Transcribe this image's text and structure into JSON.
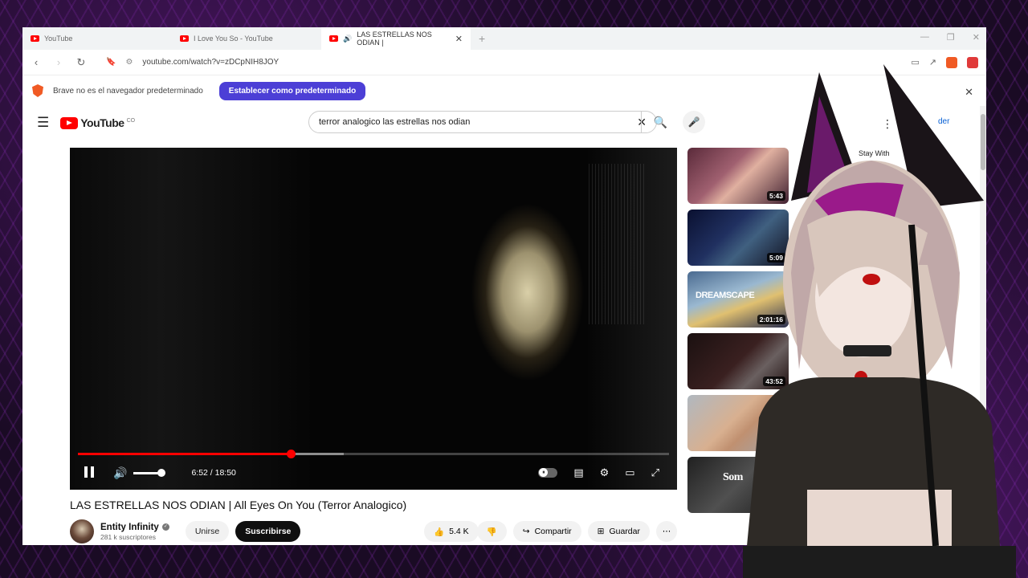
{
  "browser": {
    "tabs": [
      {
        "title": "YouTube"
      },
      {
        "title": "I Love You So - YouTube"
      },
      {
        "title": "LAS ESTRELLAS NOS ODIAN |"
      }
    ],
    "url": "youtube.com/watch?v=zDCpNIH8JOY"
  },
  "infobar": {
    "message": "Brave no es el navegador predeterminado",
    "button": "Establecer como predeterminado"
  },
  "youtube": {
    "logo_text": "YouTube",
    "country": "CO",
    "search_query": "terror analogico las estrellas nos odian",
    "signin": "der"
  },
  "player": {
    "time": "6:52 / 18:50",
    "progress": 0.36,
    "buffered": 0.45,
    "volume": 0.8
  },
  "video": {
    "title": "LAS ESTRELLAS NOS ODIAN | All Eyes On You (Terror Analogico)",
    "channel": "Entity Infinity",
    "subscribers": "281 k suscriptores",
    "join_label": "Unirse",
    "subscribe_label": "Suscribirse",
    "likes": "5.4 K",
    "share_label": "Compartir",
    "save_label": "Guardar"
  },
  "sidebar": {
    "items": [
      {
        "duration": "5:43",
        "thumb_text": ""
      },
      {
        "duration": "5:09",
        "thumb_text": ""
      },
      {
        "duration": "2:01:16",
        "thumb_text": "DREAMSCAPE"
      },
      {
        "duration": "43:52",
        "thumb_text": ""
      },
      {
        "duration": "",
        "thumb_text": ""
      },
      {
        "duration": "",
        "thumb_text": "Som"
      }
    ],
    "snippet_1": "Stay With"
  },
  "colors": {
    "accent": "#ff0000",
    "brave_button": "#4c3fd6"
  }
}
